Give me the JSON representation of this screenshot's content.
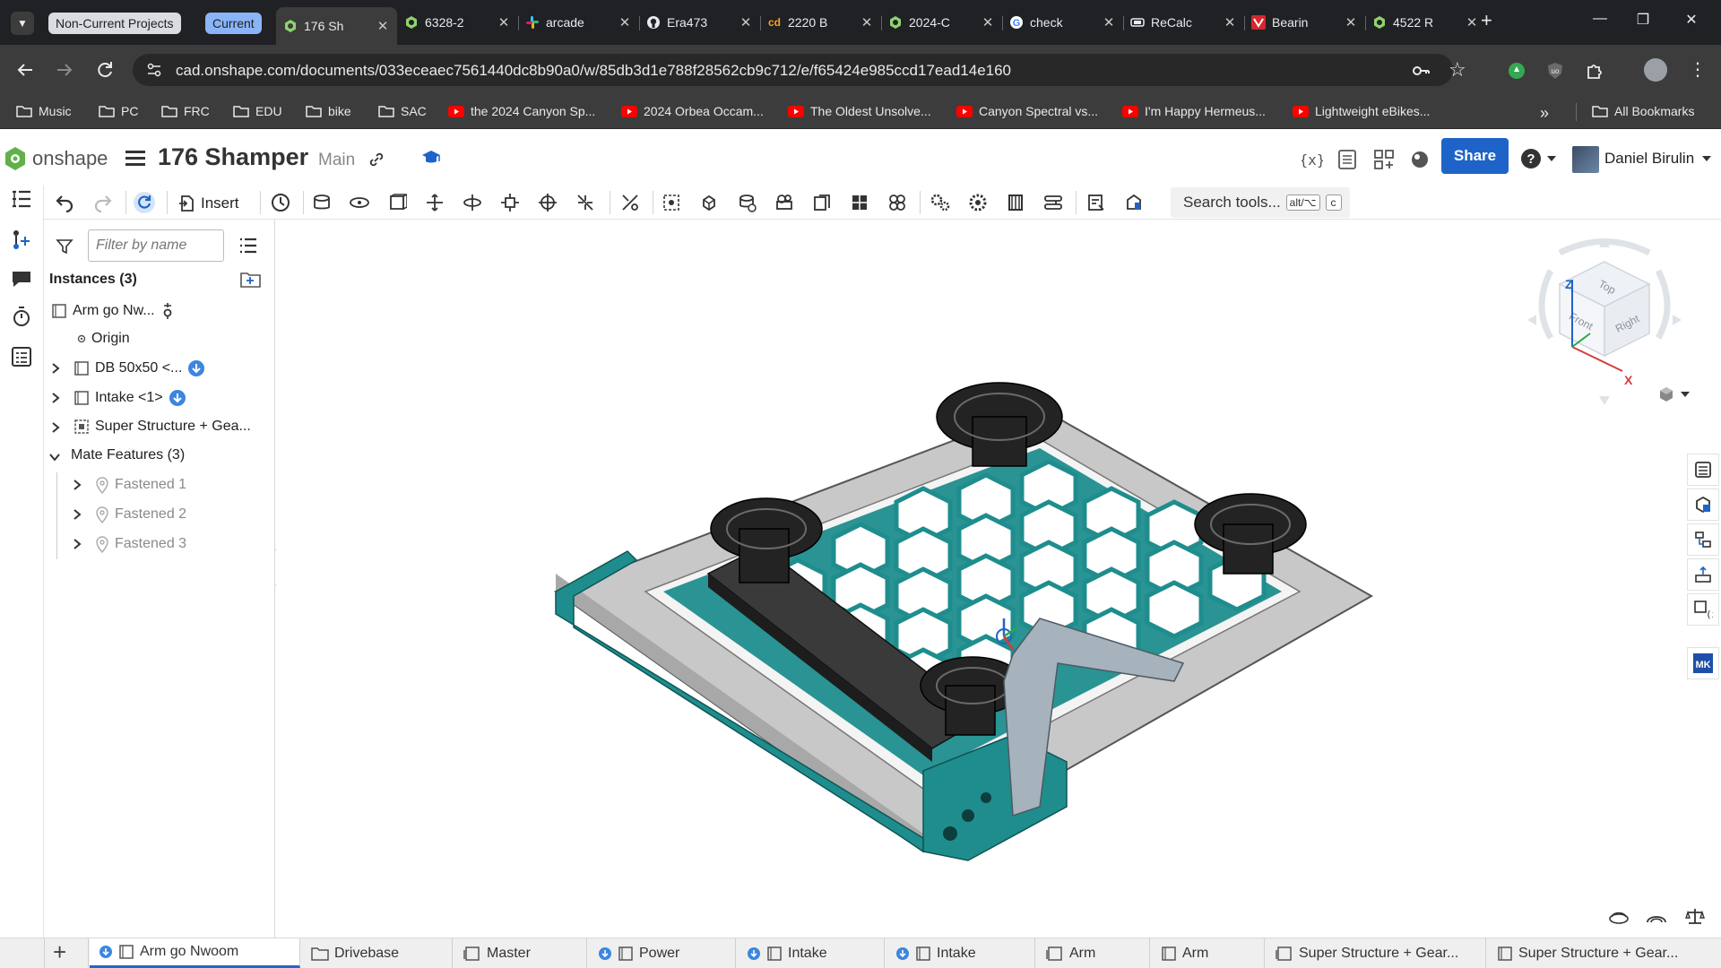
{
  "browser": {
    "tab_groups": [
      {
        "label": "Non-Current Projects",
        "bg": "#dadce0",
        "fg": "#202124"
      },
      {
        "label": "Current",
        "bg": "#8ab4f8",
        "fg": "#202124"
      }
    ],
    "tabs": [
      {
        "title": "176 Sh",
        "icon": "onshape-icon",
        "active": true
      },
      {
        "title": "6328-2",
        "icon": "onshape-icon"
      },
      {
        "title": "arcade",
        "icon": "slack-icon"
      },
      {
        "title": "Era473",
        "icon": "github-icon"
      },
      {
        "title": "2220 B",
        "icon": "cd-icon"
      },
      {
        "title": "2024-C",
        "icon": "onshape-icon"
      },
      {
        "title": "check",
        "icon": "google-icon"
      },
      {
        "title": "ReCalc",
        "icon": "recalc-icon"
      },
      {
        "title": "Bearin",
        "icon": "vex-icon"
      },
      {
        "title": "4522 R",
        "icon": "onshape-icon"
      }
    ],
    "url": "cad.onshape.com/documents/033eceaec7561440dc8b90a0/w/85db3d1e788f28562cb9c712/e/f65424e985ccd17ead14e160",
    "bookmarks": [
      {
        "label": "Music",
        "icon": "folder-icon"
      },
      {
        "label": "PC",
        "icon": "folder-icon"
      },
      {
        "label": "FRC",
        "icon": "folder-icon"
      },
      {
        "label": "EDU",
        "icon": "folder-icon"
      },
      {
        "label": "bike",
        "icon": "folder-icon"
      },
      {
        "label": "SAC",
        "icon": "folder-icon"
      },
      {
        "label": "the 2024 Canyon Sp...",
        "icon": "youtube-icon"
      },
      {
        "label": "2024 Orbea Occam...",
        "icon": "youtube-icon"
      },
      {
        "label": "The Oldest Unsolve...",
        "icon": "youtube-icon"
      },
      {
        "label": "Canyon Spectral vs...",
        "icon": "youtube-icon"
      },
      {
        "label": "I'm Happy Hermeus...",
        "icon": "youtube-icon"
      },
      {
        "label": "Lightweight eBikes...",
        "icon": "youtube-icon"
      }
    ],
    "all_bookmarks": "All Bookmarks",
    "overflow": "»"
  },
  "app": {
    "logo_text": "onshape",
    "doc_title": "176 Shamper",
    "branch": "Main",
    "share_label": "Share",
    "user_name": "Daniel Birulin",
    "insert_label": "Insert",
    "search_tools": "Search tools...",
    "search_shortcut_1": "alt/⌥",
    "search_shortcut_2": "c",
    "brand_color": "#1e64c8"
  },
  "panel": {
    "filter_placeholder": "Filter by name",
    "instances_header": "Instances (3)",
    "root_item": "Arm go Nw...",
    "origin": "Origin",
    "items": [
      {
        "label": "DB 50x50 <...",
        "download": true
      },
      {
        "label": "Intake <1>",
        "download": true
      },
      {
        "label": "Super Structure + Gea...",
        "download": false
      }
    ],
    "mate_header": "Mate Features (3)",
    "mates": [
      "Fastened 1",
      "Fastened 2",
      "Fastened 3"
    ]
  },
  "viewcube": {
    "top": "Top",
    "front": "Front",
    "right": "Right",
    "z": "Z",
    "x": "X"
  },
  "bottom_tabs": [
    {
      "label": "Arm go Nwoom",
      "active": true,
      "linked": true
    },
    {
      "label": "Drivebase",
      "linked": false
    },
    {
      "label": "Master",
      "linked": false
    },
    {
      "label": "Power",
      "linked": true
    },
    {
      "label": "Intake",
      "linked": true
    },
    {
      "label": "Intake",
      "linked": true
    },
    {
      "label": "Arm",
      "linked": false
    },
    {
      "label": "Arm",
      "linked": false
    },
    {
      "label": "Super Structure + Gear...",
      "linked": false
    },
    {
      "label": "Super Structure + Gear...",
      "linked": false
    }
  ]
}
